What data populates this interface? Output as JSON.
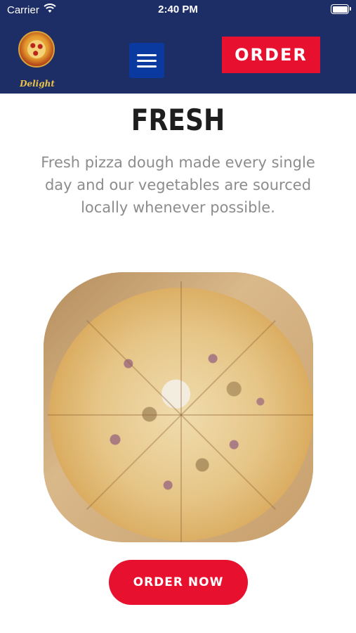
{
  "status_bar": {
    "carrier": "Carrier",
    "time": "2:40 PM"
  },
  "header": {
    "logo_text": "Pizza Delight",
    "logo_word": "Delight",
    "menu_icon": "hamburger-menu-icon",
    "order_label": "ORDER"
  },
  "main": {
    "title": "FRESH",
    "description": "Fresh pizza dough made every single day and our vegetables are sourced locally whenever possible.",
    "image_alt": "pizza",
    "order_now_label": "ORDER NOW"
  },
  "colors": {
    "header_bg": "#1d2d66",
    "accent_red": "#e8102f",
    "menu_blue": "#0a3aa0",
    "title_text": "#1e1e1e",
    "body_text": "#8c8c8c"
  }
}
